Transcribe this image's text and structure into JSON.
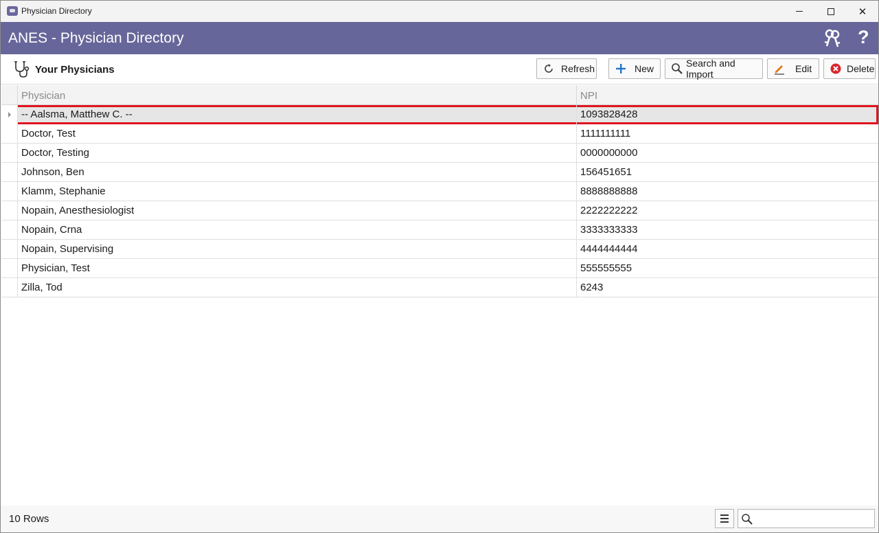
{
  "window": {
    "title": "Physician Directory",
    "controls": {
      "minimize": "minimize",
      "maximize": "maximize",
      "close": "✕"
    }
  },
  "banner": {
    "title": "ANES - Physician Directory",
    "help_label": "?",
    "icons": {
      "keys": "keys-icon",
      "help": "help-icon"
    }
  },
  "toolbar": {
    "title": "Your Physicians",
    "icon": "stethoscope-icon",
    "buttons": {
      "refresh": {
        "label": "Refresh",
        "icon": "refresh-icon"
      },
      "new": {
        "label": "New",
        "icon": "plus-icon"
      },
      "search_import": {
        "label": "Search and Import",
        "icon": "magnifier-icon"
      },
      "edit": {
        "label": "Edit",
        "icon": "pencil-icon"
      },
      "delete": {
        "label": "Delete",
        "icon": "delete-icon"
      }
    }
  },
  "grid": {
    "columns": {
      "physician": "Physician",
      "npi": "NPI"
    },
    "rows": [
      {
        "physician": "-- Aalsma, Matthew C. --",
        "npi": "1093828428",
        "selected": true
      },
      {
        "physician": "Doctor, Test",
        "npi": "1111111111"
      },
      {
        "physician": "Doctor, Testing",
        "npi": "0000000000"
      },
      {
        "physician": "Johnson, Ben",
        "npi": "156451651"
      },
      {
        "physician": "Klamm, Stephanie",
        "npi": "8888888888"
      },
      {
        "physician": "Nopain, Anesthesiologist",
        "npi": "2222222222"
      },
      {
        "physician": "Nopain, Crna",
        "npi": "3333333333"
      },
      {
        "physician": "Nopain, Supervising",
        "npi": "4444444444"
      },
      {
        "physician": "Physician, Test",
        "npi": "555555555"
      },
      {
        "physician": "Zilla, Tod",
        "npi": "6243"
      }
    ]
  },
  "status": {
    "row_count": "10 Rows",
    "search_value": "",
    "icons": {
      "menu": "hamburger-menu-icon",
      "search": "search-icon"
    }
  },
  "colors": {
    "banner": "#67669a",
    "selection_outline": "#e0141e",
    "selected_row": "#e6e6e6",
    "new_plus": "#1f74c8",
    "delete_red": "#d9262b",
    "edit_orange": "#e07a1b"
  }
}
